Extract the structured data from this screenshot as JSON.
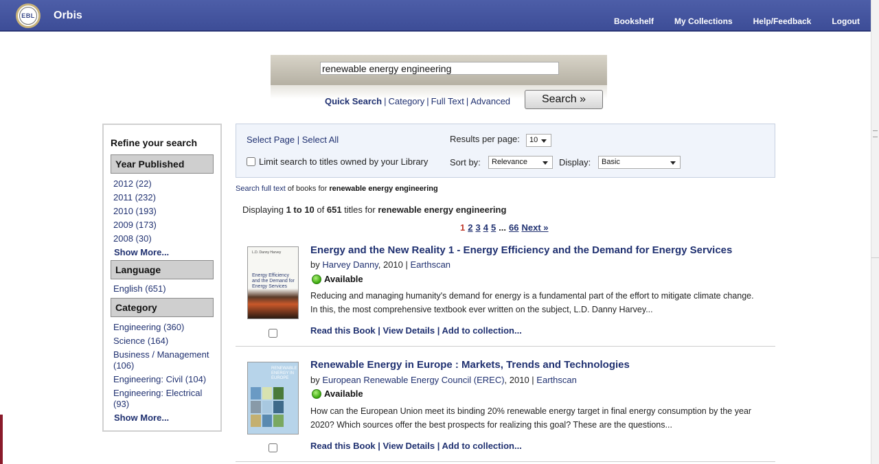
{
  "header": {
    "logo_text": "EBL",
    "app_title": "Orbis",
    "nav": [
      "Bookshelf",
      "My Collections",
      "Help/Feedback",
      "Logout"
    ]
  },
  "search": {
    "query": "renewable energy engineering",
    "links": [
      "Quick Search",
      "Category",
      "Full Text",
      "Advanced"
    ],
    "button_label": "Search »"
  },
  "refine": {
    "title": "Refine your search",
    "year": {
      "heading": "Year Published",
      "items": [
        "2012 (22)",
        "2011 (232)",
        "2010 (193)",
        "2009 (173)",
        "2008 (30)"
      ],
      "show_more": "Show More..."
    },
    "language": {
      "heading": "Language",
      "items": [
        "English (651)"
      ]
    },
    "category": {
      "heading": "Category",
      "items": [
        "Engineering (360)",
        "Science (164)",
        "Business / Management (106)",
        "Engineering: Civil (104)",
        "Engineering: Electrical (93)"
      ],
      "show_more": "Show More..."
    }
  },
  "options": {
    "select_page": "Select Page",
    "select_all": "Select All",
    "limit_label": "Limit search to titles owned by your Library",
    "results_per_page_label": "Results per page:",
    "results_per_page_value": "10",
    "sort_by_label": "Sort by:",
    "sort_by_value": "Relevance",
    "display_label": "Display:",
    "display_value": "Basic"
  },
  "fulltext": {
    "link": "Search full text",
    "middle": " of books for ",
    "query": "renewable energy engineering"
  },
  "summary": {
    "prefix": "Displaying ",
    "range": "1 to 10",
    "of": " of ",
    "total": "651",
    "suffix": " titles for ",
    "query": "renewable energy engineering"
  },
  "pager": {
    "current": "1",
    "pages": [
      "2",
      "3",
      "4",
      "5"
    ],
    "ellipsis": "...",
    "last": "66",
    "next": "Next »"
  },
  "results": [
    {
      "title": "Energy and the New Reality 1 - Energy Efficiency and the Demand for Energy Services",
      "by": "by ",
      "author": "Harvey Danny",
      "year": ", 2010 | ",
      "publisher": "Earthscan",
      "availability": "Available",
      "description": "Reducing and managing humanity's demand for energy is a fundamental part of the effort to mitigate climate change. In this, the most comprehensive textbook ever written on the subject, L.D. Danny Harvey...",
      "actions": [
        "Read this Book",
        "View Details",
        "Add to collection..."
      ],
      "cover_series": "L.D. Danny Harvey",
      "cover_title": "Energy Efficiency and the Demand for Energy Services"
    },
    {
      "title": "Renewable Energy in Europe : Markets, Trends and Technologies",
      "by": "by ",
      "author": "European Renewable Energy Council (EREC)",
      "year": ", 2010 | ",
      "publisher": "Earthscan",
      "availability": "Available",
      "description": "How can the European Union meet its binding 20% renewable energy target in final energy consumption by the year 2020? Which sources offer the best prospects for realizing this goal? These are the questions...",
      "actions": [
        "Read this Book",
        "View Details",
        "Add to collection..."
      ],
      "cover_title": "RENEWABLE ENERGY IN EUROPE"
    }
  ]
}
